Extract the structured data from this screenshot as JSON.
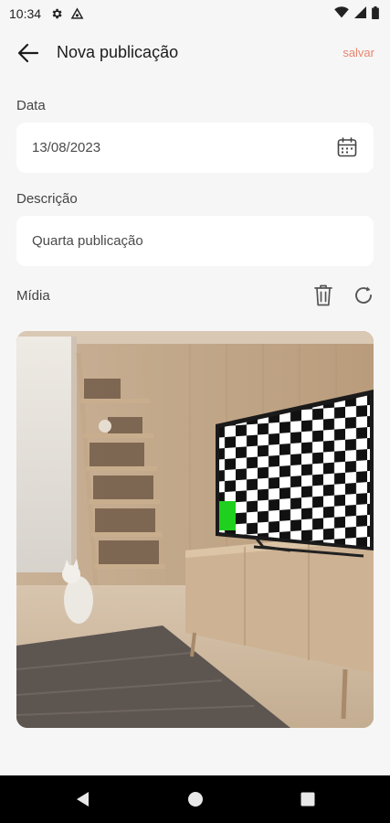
{
  "status_bar": {
    "time": "10:34",
    "icons": [
      "gear-icon",
      "vpn-icon",
      "wifi-icon",
      "signal-icon",
      "battery-icon"
    ]
  },
  "app_bar": {
    "title": "Nova publicação",
    "save_label": "salvar",
    "back_icon": "arrow-left-icon"
  },
  "form": {
    "date": {
      "label": "Data",
      "value": "13/08/2023",
      "icon": "calendar-icon"
    },
    "description": {
      "label": "Descrição",
      "value": "Quarta publicação"
    },
    "media": {
      "label": "Mídia",
      "delete_icon": "trash-icon",
      "replace_icon": "refresh-icon"
    }
  },
  "nav_bar": {
    "icons": [
      "back-triangle-icon",
      "home-circle-icon",
      "recents-square-icon"
    ]
  },
  "colors": {
    "accent": "#e8866f",
    "background": "#f6f6f6",
    "field_bg": "#ffffff"
  }
}
